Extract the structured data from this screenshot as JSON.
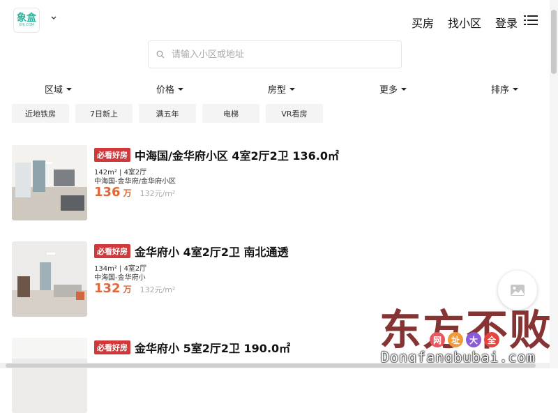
{
  "header": {
    "logo_line1": "象盒",
    "logo_line2": "XHJ.COM",
    "nav": [
      "买房",
      "找小区",
      "登录"
    ]
  },
  "search": {
    "placeholder": "请输入小区或地址"
  },
  "filters": [
    "区域",
    "价格",
    "房型",
    "更多",
    "排序"
  ],
  "chips": [
    "近地铁房",
    "7日新上",
    "满五年",
    "电梯",
    "VR看房"
  ],
  "listings": [
    {
      "tag": "必看好房",
      "title": "中海国/金华府小区 4室2厅2卫 136.0㎡",
      "meta1": "142m² | 4室2厅",
      "meta2": "中海国-金华府/金华府小区",
      "price": "136",
      "price_unit": "万",
      "ppm": "132元/m²"
    },
    {
      "tag": "必看好房",
      "title": "金华府小 4室2厅2卫 南北通透",
      "meta1": "134m² | 4室2厅",
      "meta2": "中海国-金华府小",
      "price": "132",
      "price_unit": "万",
      "ppm": "132元/m²"
    },
    {
      "tag": "必看好房",
      "title": "金华府小 5室2厅2卫 190.0㎡",
      "meta1": "",
      "meta2": "",
      "price": "",
      "price_unit": "",
      "ppm": ""
    }
  ],
  "watermark": {
    "big": "东方不败",
    "dots": [
      "网",
      "址",
      "大",
      "全"
    ],
    "url": "Dongfangbubai.com"
  },
  "colors": {
    "brand": "#2db7a0",
    "tag": "#d0383b",
    "price": "#e0673a"
  }
}
